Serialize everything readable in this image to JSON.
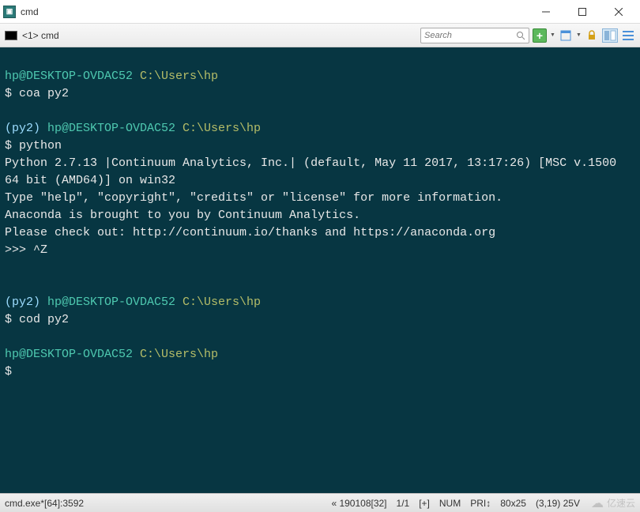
{
  "titlebar": {
    "title": "cmd"
  },
  "toolbar": {
    "tab_label": "<1> cmd",
    "search_placeholder": "Search"
  },
  "terminal": {
    "lines": [
      {
        "segments": []
      },
      {
        "segments": [
          {
            "cls": "user",
            "t": "hp@DESKTOP-OVDAC52 "
          },
          {
            "cls": "path",
            "t": "C:\\Users\\hp"
          }
        ]
      },
      {
        "segments": [
          {
            "cls": "white",
            "t": "$ coa py2"
          }
        ]
      },
      {
        "segments": []
      },
      {
        "segments": [
          {
            "cls": "env",
            "t": "(py2) "
          },
          {
            "cls": "user",
            "t": "hp@DESKTOP-OVDAC52 "
          },
          {
            "cls": "path",
            "t": "C:\\Users\\hp"
          }
        ]
      },
      {
        "segments": [
          {
            "cls": "white",
            "t": "$ python"
          }
        ]
      },
      {
        "segments": [
          {
            "cls": "white",
            "t": "Python 2.7.13 |Continuum Analytics, Inc.| (default, May 11 2017, 13:17:26) [MSC v.1500 64 bit (AMD64)] on win32"
          }
        ]
      },
      {
        "segments": [
          {
            "cls": "white",
            "t": "Type \"help\", \"copyright\", \"credits\" or \"license\" for more information."
          }
        ]
      },
      {
        "segments": [
          {
            "cls": "white",
            "t": "Anaconda is brought to you by Continuum Analytics."
          }
        ]
      },
      {
        "segments": [
          {
            "cls": "white",
            "t": "Please check out: http://continuum.io/thanks and https://anaconda.org"
          }
        ]
      },
      {
        "segments": [
          {
            "cls": "white",
            "t": ">>> ^Z"
          }
        ]
      },
      {
        "segments": []
      },
      {
        "segments": []
      },
      {
        "segments": [
          {
            "cls": "env",
            "t": "(py2) "
          },
          {
            "cls": "user",
            "t": "hp@DESKTOP-OVDAC52 "
          },
          {
            "cls": "path",
            "t": "C:\\Users\\hp"
          }
        ]
      },
      {
        "segments": [
          {
            "cls": "white",
            "t": "$ cod py2"
          }
        ]
      },
      {
        "segments": []
      },
      {
        "segments": [
          {
            "cls": "user",
            "t": "hp@DESKTOP-OVDAC52 "
          },
          {
            "cls": "path",
            "t": "C:\\Users\\hp"
          }
        ]
      },
      {
        "segments": [
          {
            "cls": "white",
            "t": "$"
          }
        ]
      }
    ]
  },
  "statusbar": {
    "left": "cmd.exe*[64]:3592",
    "enc": "« 190108[32]",
    "pos": "1/1",
    "plus": "[+]",
    "num": "NUM",
    "pri": "PRI↕",
    "size": "80x25",
    "cursor": "(3,19) 25V",
    "watermark": "亿速云"
  }
}
